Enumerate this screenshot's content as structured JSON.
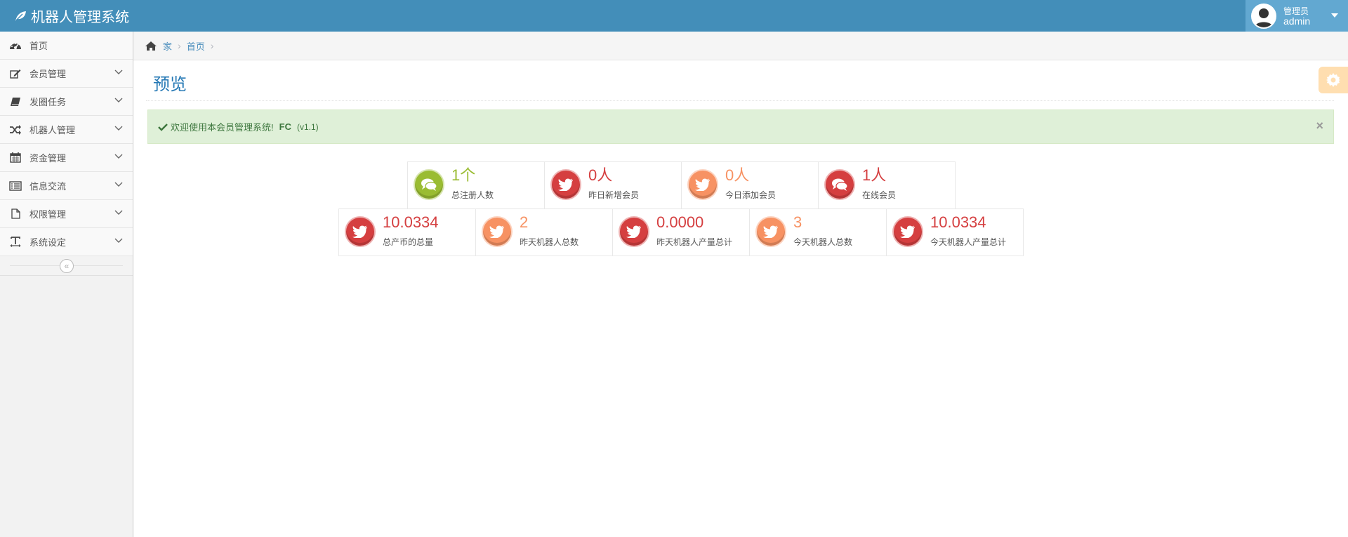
{
  "app": {
    "title": "机器人管理系统"
  },
  "user": {
    "role": "管理员",
    "name": "admin"
  },
  "sidebar": {
    "items": [
      {
        "label": "首页",
        "icon": "tachometer-icon",
        "has_submenu": false
      },
      {
        "label": "会员管理",
        "icon": "edit-icon",
        "has_submenu": true
      },
      {
        "label": "发圈任务",
        "icon": "book-icon",
        "has_submenu": true
      },
      {
        "label": "机器人管理",
        "icon": "random-icon",
        "has_submenu": true
      },
      {
        "label": "资金管理",
        "icon": "calendar-icon",
        "has_submenu": true
      },
      {
        "label": "信息交流",
        "icon": "list-alt-icon",
        "has_submenu": true
      },
      {
        "label": "权限管理",
        "icon": "file-icon",
        "has_submenu": true
      },
      {
        "label": "系统设定",
        "icon": "text-width-icon",
        "has_submenu": true
      }
    ]
  },
  "breadcrumb": {
    "home": "家",
    "current": "首页"
  },
  "page": {
    "title": "预览"
  },
  "alert": {
    "message": "欢迎使用本会员管理系统!",
    "brand": "FC",
    "version": "(v1.1)",
    "close": "×"
  },
  "stats_row1": [
    {
      "value": "1个",
      "label": "总注册人数",
      "color": "#9abc32",
      "icon": "comments-icon"
    },
    {
      "value": "0人",
      "label": "昨日新增会员",
      "color": "#d53f40",
      "icon": "twitter-icon"
    },
    {
      "value": "0人",
      "label": "今日添加会员",
      "color": "#f79263",
      "icon": "twitter-icon"
    },
    {
      "value": "1人",
      "label": "在线会员",
      "color": "#d53f40",
      "icon": "comments-icon"
    }
  ],
  "stats_row2": [
    {
      "value": "10.0334",
      "label": "总产币的总量",
      "color": "#d53f40",
      "icon": "twitter-icon"
    },
    {
      "value": "2",
      "label": "昨天机器人总数",
      "color": "#f79263",
      "icon": "twitter-icon"
    },
    {
      "value": "0.0000",
      "label": "昨天机器人产量总计",
      "color": "#d53f40",
      "icon": "twitter-icon"
    },
    {
      "value": "3",
      "label": "今天机器人总数",
      "color": "#f79263",
      "icon": "twitter-icon"
    },
    {
      "value": "10.0334",
      "label": "今天机器人产量总计",
      "color": "#d53f40",
      "icon": "twitter-icon"
    }
  ]
}
